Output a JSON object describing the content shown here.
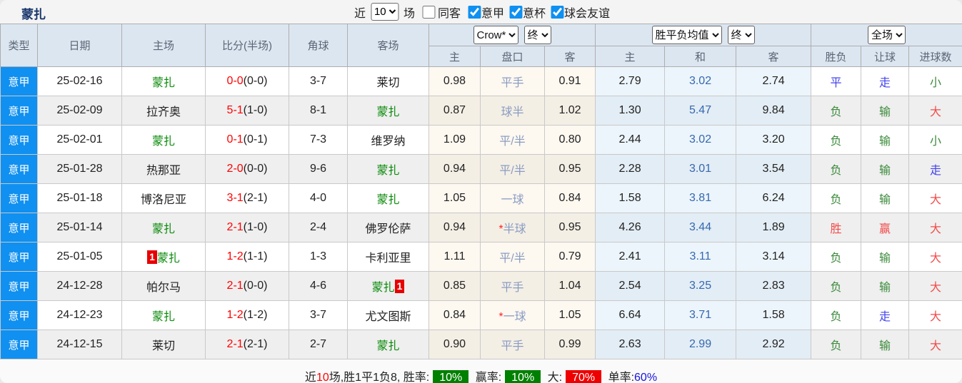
{
  "title": "蒙扎",
  "filters": {
    "near_label": "近",
    "count": "10",
    "games_label": "场",
    "same_away": {
      "label": "同客",
      "checked": false
    },
    "leagues": [
      {
        "label": "意甲",
        "checked": true
      },
      {
        "label": "意杯",
        "checked": true
      },
      {
        "label": "球会友谊",
        "checked": true
      }
    ]
  },
  "table": {
    "headers": {
      "type": "类型",
      "date": "日期",
      "home": "主场",
      "score": "比分(半场)",
      "corner": "角球",
      "away": "客场",
      "selects": {
        "bookmaker": "Crow*",
        "odds_stage": "终",
        "avg_type": "胜平负均值",
        "avg_stage": "终",
        "scope": "全场"
      },
      "odds_sub": {
        "home": "主",
        "pan": "盘口",
        "away": "客"
      },
      "avg_sub": {
        "home": "主",
        "draw": "和",
        "away": "客"
      },
      "result_sub": {
        "wl": "胜负",
        "let": "让球",
        "goals": "进球数"
      }
    },
    "rows": [
      {
        "league": "意甲",
        "date": "25-02-16",
        "home": {
          "name": "蒙扎",
          "green": true
        },
        "score": {
          "main": "0-0",
          "half": "(0-0)"
        },
        "corner": "3-7",
        "away": {
          "name": "莱切"
        },
        "odds": {
          "home": "0.98",
          "pan": "平手",
          "star": false,
          "away": "0.91"
        },
        "avg": {
          "home": "2.79",
          "draw": "3.02",
          "away": "2.74"
        },
        "result": {
          "wl": {
            "t": "平",
            "c": "blue"
          },
          "let": {
            "t": "走",
            "c": "blue"
          },
          "goal": {
            "t": "小",
            "c": "green"
          }
        }
      },
      {
        "league": "意甲",
        "date": "25-02-09",
        "home": {
          "name": "拉齐奥"
        },
        "score": {
          "main": "5-1",
          "half": "(1-0)"
        },
        "corner": "8-1",
        "away": {
          "name": "蒙扎",
          "green": true
        },
        "odds": {
          "home": "0.87",
          "pan": "球半",
          "star": false,
          "away": "1.02"
        },
        "avg": {
          "home": "1.30",
          "draw": "5.47",
          "away": "9.84"
        },
        "result": {
          "wl": {
            "t": "负",
            "c": "green"
          },
          "let": {
            "t": "输",
            "c": "green"
          },
          "goal": {
            "t": "大",
            "c": "red"
          }
        }
      },
      {
        "league": "意甲",
        "date": "25-02-01",
        "home": {
          "name": "蒙扎",
          "green": true
        },
        "score": {
          "main": "0-1",
          "half": "(0-1)"
        },
        "corner": "7-3",
        "away": {
          "name": "维罗纳"
        },
        "odds": {
          "home": "1.09",
          "pan": "平/半",
          "star": false,
          "away": "0.80"
        },
        "avg": {
          "home": "2.44",
          "draw": "3.02",
          "away": "3.20"
        },
        "result": {
          "wl": {
            "t": "负",
            "c": "green"
          },
          "let": {
            "t": "输",
            "c": "green"
          },
          "goal": {
            "t": "小",
            "c": "green"
          }
        }
      },
      {
        "league": "意甲",
        "date": "25-01-28",
        "home": {
          "name": "热那亚"
        },
        "score": {
          "main": "2-0",
          "half": "(0-0)"
        },
        "corner": "9-6",
        "away": {
          "name": "蒙扎",
          "green": true
        },
        "odds": {
          "home": "0.94",
          "pan": "平/半",
          "star": false,
          "away": "0.95"
        },
        "avg": {
          "home": "2.28",
          "draw": "3.01",
          "away": "3.54"
        },
        "result": {
          "wl": {
            "t": "负",
            "c": "green"
          },
          "let": {
            "t": "输",
            "c": "green"
          },
          "goal": {
            "t": "走",
            "c": "blue"
          }
        }
      },
      {
        "league": "意甲",
        "date": "25-01-18",
        "home": {
          "name": "博洛尼亚"
        },
        "score": {
          "main": "3-1",
          "half": "(2-1)"
        },
        "corner": "4-0",
        "away": {
          "name": "蒙扎",
          "green": true
        },
        "odds": {
          "home": "1.05",
          "pan": "一球",
          "star": false,
          "away": "0.84"
        },
        "avg": {
          "home": "1.58",
          "draw": "3.81",
          "away": "6.24"
        },
        "result": {
          "wl": {
            "t": "负",
            "c": "green"
          },
          "let": {
            "t": "输",
            "c": "green"
          },
          "goal": {
            "t": "大",
            "c": "red"
          }
        }
      },
      {
        "league": "意甲",
        "date": "25-01-14",
        "home": {
          "name": "蒙扎",
          "green": true
        },
        "score": {
          "main": "2-1",
          "half": "(1-0)"
        },
        "corner": "2-4",
        "away": {
          "name": "佛罗伦萨"
        },
        "odds": {
          "home": "0.94",
          "pan": "半球",
          "star": true,
          "away": "0.95"
        },
        "avg": {
          "home": "4.26",
          "draw": "3.44",
          "away": "1.89"
        },
        "result": {
          "wl": {
            "t": "胜",
            "c": "red"
          },
          "let": {
            "t": "赢",
            "c": "red"
          },
          "goal": {
            "t": "大",
            "c": "red"
          }
        }
      },
      {
        "league": "意甲",
        "date": "25-01-05",
        "home": {
          "name": "蒙扎",
          "green": true,
          "card": "1",
          "card_pos": "before"
        },
        "score": {
          "main": "1-2",
          "half": "(1-1)"
        },
        "corner": "1-3",
        "away": {
          "name": "卡利亚里"
        },
        "odds": {
          "home": "1.11",
          "pan": "平/半",
          "star": false,
          "away": "0.79"
        },
        "avg": {
          "home": "2.41",
          "draw": "3.11",
          "away": "3.14"
        },
        "result": {
          "wl": {
            "t": "负",
            "c": "green"
          },
          "let": {
            "t": "输",
            "c": "green"
          },
          "goal": {
            "t": "大",
            "c": "red"
          }
        }
      },
      {
        "league": "意甲",
        "date": "24-12-28",
        "home": {
          "name": "帕尔马"
        },
        "score": {
          "main": "2-1",
          "half": "(0-0)"
        },
        "corner": "4-6",
        "away": {
          "name": "蒙扎",
          "green": true,
          "card": "1",
          "card_pos": "after"
        },
        "odds": {
          "home": "0.85",
          "pan": "平手",
          "star": false,
          "away": "1.04"
        },
        "avg": {
          "home": "2.54",
          "draw": "3.25",
          "away": "2.83"
        },
        "result": {
          "wl": {
            "t": "负",
            "c": "green"
          },
          "let": {
            "t": "输",
            "c": "green"
          },
          "goal": {
            "t": "大",
            "c": "red"
          }
        }
      },
      {
        "league": "意甲",
        "date": "24-12-23",
        "home": {
          "name": "蒙扎",
          "green": true
        },
        "score": {
          "main": "1-2",
          "half": "(1-2)"
        },
        "corner": "3-7",
        "away": {
          "name": "尤文图斯"
        },
        "odds": {
          "home": "0.84",
          "pan": "一球",
          "star": true,
          "away": "1.05"
        },
        "avg": {
          "home": "6.64",
          "draw": "3.71",
          "away": "1.58"
        },
        "result": {
          "wl": {
            "t": "负",
            "c": "green"
          },
          "let": {
            "t": "走",
            "c": "blue"
          },
          "goal": {
            "t": "大",
            "c": "red"
          }
        }
      },
      {
        "league": "意甲",
        "date": "24-12-15",
        "home": {
          "name": "莱切"
        },
        "score": {
          "main": "2-1",
          "half": "(2-1)"
        },
        "corner": "2-7",
        "away": {
          "name": "蒙扎",
          "green": true
        },
        "odds": {
          "home": "0.90",
          "pan": "平手",
          "star": false,
          "away": "0.99"
        },
        "avg": {
          "home": "2.63",
          "draw": "2.99",
          "away": "2.92"
        },
        "result": {
          "wl": {
            "t": "负",
            "c": "green"
          },
          "let": {
            "t": "输",
            "c": "green"
          },
          "goal": {
            "t": "大",
            "c": "red"
          }
        }
      }
    ]
  },
  "summary": {
    "near_label": "近",
    "near_num": "10",
    "record_text": "场,胜1平1负8, 胜率:",
    "win_rate": "10%",
    "handicap_label": "赢率:",
    "handicap_rate": "10%",
    "big_label": "大:",
    "big_rate": "70%",
    "odd_label": "单率:",
    "odd_rate": "60%"
  },
  "colors": {
    "accent_blue": "#1090f0",
    "monza_green": "#0a8a0a",
    "score_red": "#ff0000",
    "result_red": "#f34b4b",
    "result_green": "#3b8a3b",
    "result_blue": "#4343ee",
    "draw_avg_blue": "#3568b0",
    "badge_green_bg": "#008000",
    "badge_red_bg": "#ee0000"
  }
}
